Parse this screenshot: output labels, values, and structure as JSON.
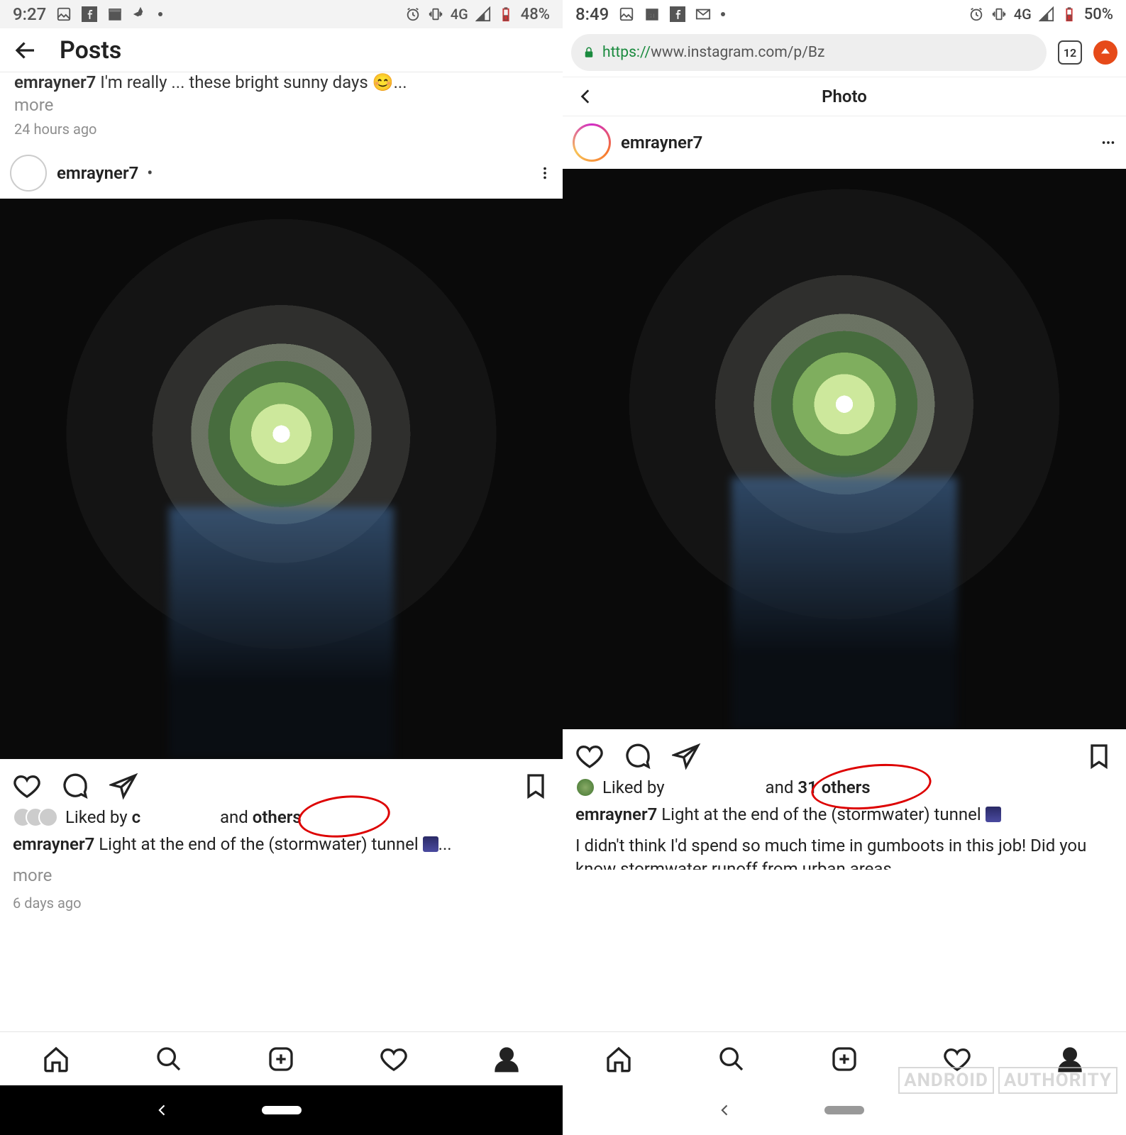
{
  "left": {
    "status": {
      "time": "9:27",
      "network": "4G",
      "battery": "48%"
    },
    "header": {
      "title": "Posts"
    },
    "prev_caption_fragment": "I'm really ... these bright sunny days 😊...",
    "prev_more": "more",
    "prev_timestamp": "24 hours ago",
    "post": {
      "user": "emrayner7",
      "user_suffix": " •",
      "liked_by_prefix": "Liked by ",
      "liked_by_hidden_name": "c",
      "liked_by_and": " and ",
      "liked_by_others": "others",
      "caption": "Light at the end of the (stormwater) tunnel ",
      "caption_ellipsis": "...",
      "more": "more",
      "timestamp": "6 days ago"
    }
  },
  "right": {
    "status": {
      "time": "8:49",
      "network": "4G",
      "battery": "50%"
    },
    "url": {
      "https": "https://",
      "rest": "www.instagram.com/p/Bz",
      "tab_count": "12"
    },
    "header": {
      "title": "Photo"
    },
    "post": {
      "user": "emrayner7",
      "liked_by_prefix": "Liked by ",
      "liked_by_and": "and ",
      "liked_by_count": "31 others",
      "caption": "Light at the end of the (stormwater) tunnel ",
      "body": "I didn't think I'd spend so much time in gumboots in this job! Did you know stormwater runoff from urban areas"
    }
  },
  "watermark": {
    "a": "ANDROID",
    "b": "AUTHORITY"
  }
}
